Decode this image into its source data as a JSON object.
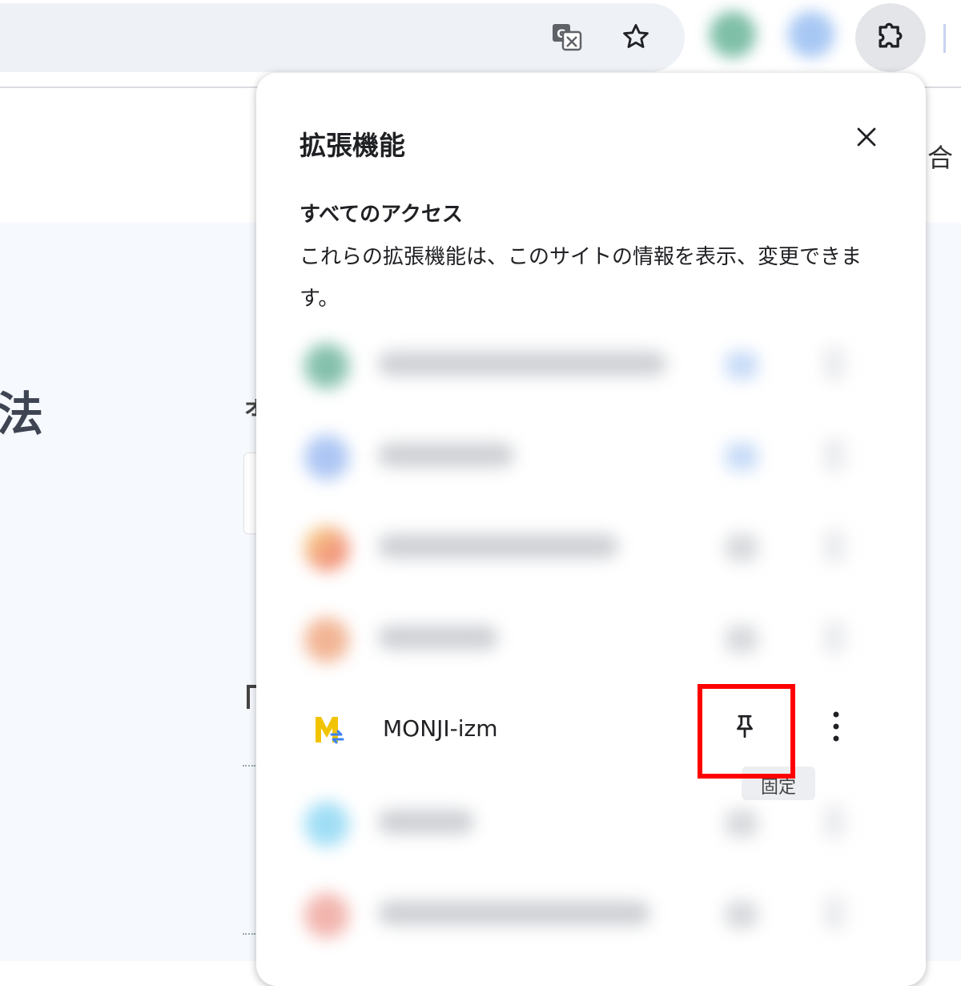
{
  "toolbar": {
    "translate_icon": "translate-icon",
    "bookmark_icon": "star-icon",
    "extensions_icon": "puzzle-icon"
  },
  "page": {
    "heading_fragment": "法",
    "right_fragment": "合",
    "mid_fragment": "ォ"
  },
  "popup": {
    "title": "拡張機能",
    "close_icon": "close-icon",
    "section_title": "すべてのアクセス",
    "section_description": "これらの拡張機能は、このサイトの情報を表示、変更できます。",
    "featured_extension": {
      "name": "MONJI-izm",
      "pin_icon": "pin-icon",
      "more_icon": "more-vert-icon",
      "pin_tooltip": "固定"
    }
  },
  "colors": {
    "highlight": "#ff0000",
    "popup_bg": "#ffffff",
    "page_bg": "#f6f9fd"
  }
}
